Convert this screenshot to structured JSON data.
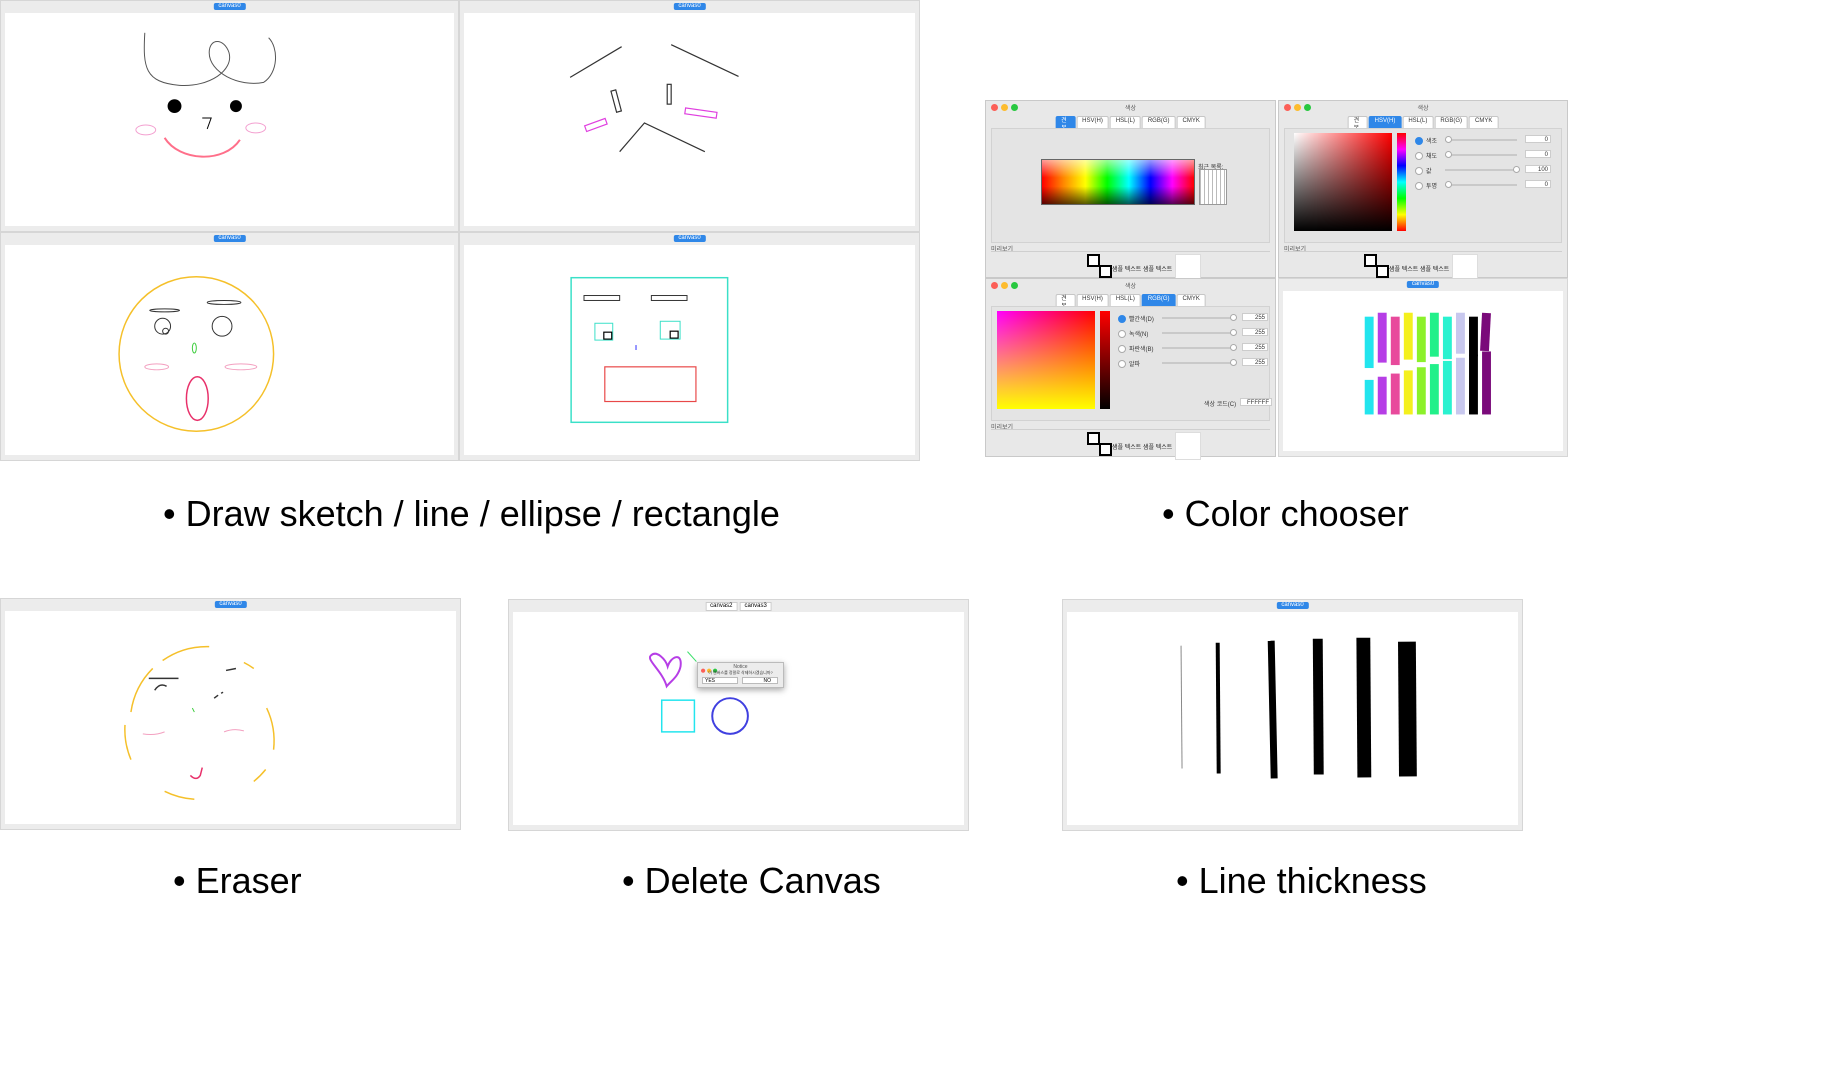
{
  "captions": {
    "draw": "• Draw sketch / line / ellipse / rectangle",
    "color": "• Color chooser",
    "eraser": "• Eraser",
    "delete": "• Delete Canvas",
    "thickness": "• Line thickness"
  },
  "tabs": {
    "canvas": "canvas0",
    "canvas2": "canvas2",
    "canvas3": "canvas3"
  },
  "notice_dialog": {
    "title": "Notice",
    "message": "이 캔버스를 정말로 삭제하시겠습니까?",
    "yes": "YES",
    "no": "NO"
  },
  "color_chooser": {
    "title": "색상",
    "tabs": [
      "견본(S)",
      "HSV(H)",
      "HSL(L)",
      "RGB(G)",
      "CMYK"
    ],
    "recent_label": "최근 목록:",
    "preview_label": "미리보기",
    "sample_text": "샘플 텍스트",
    "hsv_rows": [
      {
        "label": "색조",
        "value": "0"
      },
      {
        "label": "채도",
        "value": "0"
      },
      {
        "label": "값",
        "value": "100"
      },
      {
        "label": "투명",
        "value": "0"
      }
    ],
    "rgb_rows": [
      {
        "label": "빨간색(D)",
        "value": "255"
      },
      {
        "label": "녹색(N)",
        "value": "255"
      },
      {
        "label": "파란색(B)",
        "value": "255"
      },
      {
        "label": "알파",
        "value": "255"
      }
    ],
    "color_code_label": "색상 코드(C)",
    "color_code": "FFFFFF"
  },
  "color_chart": {
    "top_colors": [
      "#22e5ee",
      "#b63ee6",
      "#e84a9c",
      "#f4f01d",
      "#8cf12a",
      "#22f08a",
      "#2af2d0",
      "#c8c8ee",
      "#000000",
      "#7a0a7a"
    ],
    "bottom_colors": [
      "#22e5ee",
      "#b63ee6",
      "#e84a9c",
      "#f4f01d",
      "#8cf12a",
      "#22f08a",
      "#2af2d0",
      "#c8c8ee",
      "#000000",
      "#7a0a7a"
    ]
  },
  "line_thickness": {
    "widths": [
      1,
      4,
      7,
      10,
      14,
      18
    ]
  }
}
